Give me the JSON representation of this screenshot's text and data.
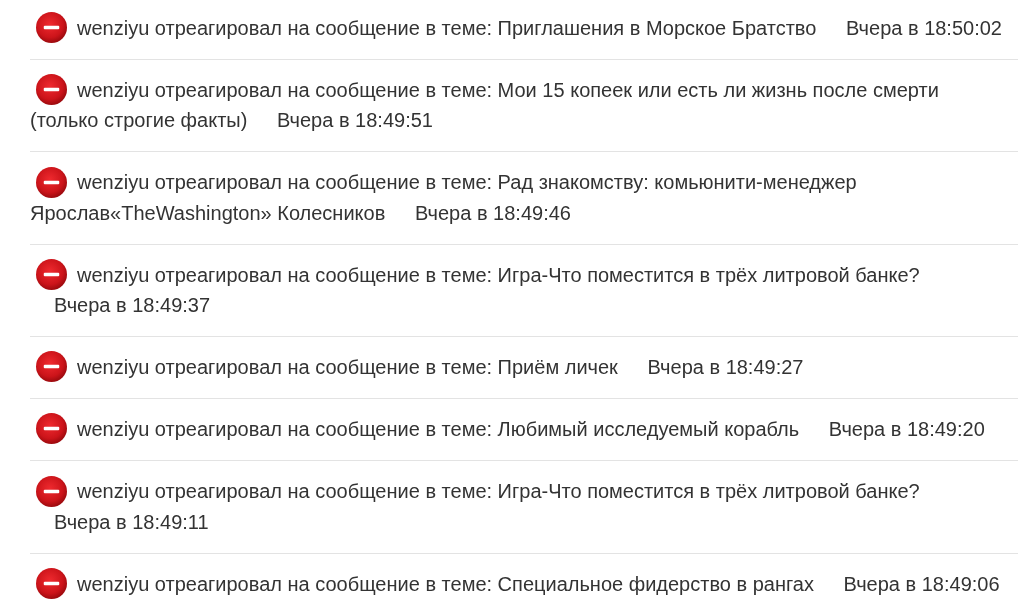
{
  "notifications": [
    {
      "message": "wenziyu отреагировал на сообщение в теме: Приглашения в Морское Братство",
      "time": "Вчера в 18:50:02"
    },
    {
      "message": "wenziyu отреагировал на сообщение в теме: Мои 15 копеек или есть ли жизнь после смерти (только строгие факты)",
      "time": "Вчера в 18:49:51"
    },
    {
      "message": "wenziyu отреагировал на сообщение в теме: Рад знакомству: комьюнити-менеджер Ярослав«TheWashington» Колесников",
      "time": "Вчера в 18:49:46"
    },
    {
      "message": "wenziyu отреагировал на сообщение в теме: Игра-Что поместится в трёх литровой банке?",
      "time": "Вчера в 18:49:37"
    },
    {
      "message": "wenziyu отреагировал на сообщение в теме: Приём личек",
      "time": "Вчера в 18:49:27"
    },
    {
      "message": "wenziyu отреагировал на сообщение в теме: Любимый исследуемый корабль",
      "time": "Вчера в 18:49:20"
    },
    {
      "message": "wenziyu отреагировал на сообщение в теме: Игра-Что поместится в трёх литровой банке?",
      "time": "Вчера в 18:49:11"
    },
    {
      "message": "wenziyu отреагировал на сообщение в теме: Специальное фидерство в рангах",
      "time": "Вчера в 18:49:06"
    }
  ]
}
